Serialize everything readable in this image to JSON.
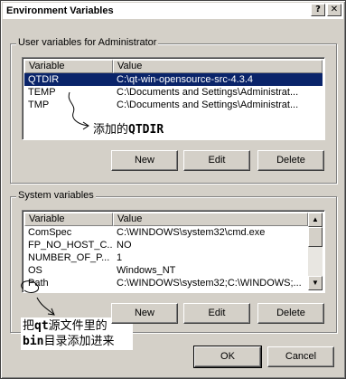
{
  "window": {
    "title": "Environment Variables",
    "help_label": "?",
    "close_label": "✕"
  },
  "user_vars": {
    "group_title": "User variables for Administrator",
    "col_variable": "Variable",
    "col_value": "Value",
    "rows": [
      {
        "name": "QTDIR",
        "value": "C:\\qt-win-opensource-src-4.3.4"
      },
      {
        "name": "TEMP",
        "value": "C:\\Documents and Settings\\Administrat..."
      },
      {
        "name": "TMP",
        "value": "C:\\Documents and Settings\\Administrat..."
      }
    ],
    "new_label": "New",
    "edit_label": "Edit",
    "delete_label": "Delete"
  },
  "system_vars": {
    "group_title": "System variables",
    "col_variable": "Variable",
    "col_value": "Value",
    "rows": [
      {
        "name": "ComSpec",
        "value": "C:\\WINDOWS\\system32\\cmd.exe"
      },
      {
        "name": "FP_NO_HOST_C...",
        "value": "NO"
      },
      {
        "name": "NUMBER_OF_P...",
        "value": "1"
      },
      {
        "name": "OS",
        "value": "Windows_NT"
      },
      {
        "name": "Path",
        "value": "C:\\WINDOWS\\system32;C:\\WINDOWS;..."
      }
    ],
    "new_label": "New",
    "edit_label": "Edit",
    "delete_label": "Delete"
  },
  "annotations": {
    "qtdir_prefix": "添加的",
    "qtdir_mono": "QTDIR",
    "path_line1_a": "把",
    "path_line1_mono": "qt",
    "path_line1_b": "源文件里的",
    "path_line2_mono": "bin",
    "path_line2_b": "目录添加进来"
  },
  "footer": {
    "ok_label": "OK",
    "cancel_label": "Cancel"
  }
}
